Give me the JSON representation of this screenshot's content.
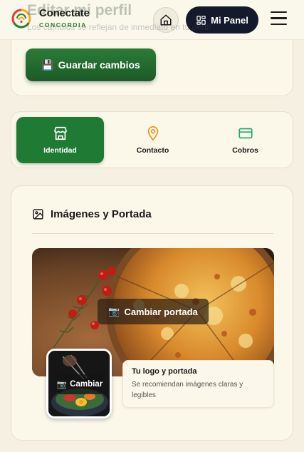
{
  "header": {
    "brand_name": "Conectate",
    "brand_sub": "CONCORDIA",
    "panel_label": "Mi Panel",
    "bg_title": "Editar mi perfil",
    "bg_subtitle": "Los cambios se reflejan de inmediato en tu perfil"
  },
  "actions": {
    "save_label": "Guardar cambios",
    "save_icon": "💾"
  },
  "tabs": [
    {
      "label": "Identidad",
      "icon": "store-icon",
      "active": true
    },
    {
      "label": "Contacto",
      "icon": "map-pin-icon",
      "active": false
    },
    {
      "label": "Cobros",
      "icon": "credit-card-icon",
      "active": false
    }
  ],
  "images_section": {
    "title": "Imágenes y Portada",
    "change_cover_label": "Cambiar portada",
    "change_logo_label": "Cambiar",
    "camera_icon": "📷",
    "info_title": "Tu logo y portada",
    "info_desc": "Se recomiendan imágenes claras y legibles"
  },
  "colors": {
    "accent_green": "#1f7a34",
    "dark_navy": "#14192b",
    "orange": "#e8931a",
    "teal": "#1ea672",
    "background": "#f5f0e1"
  }
}
